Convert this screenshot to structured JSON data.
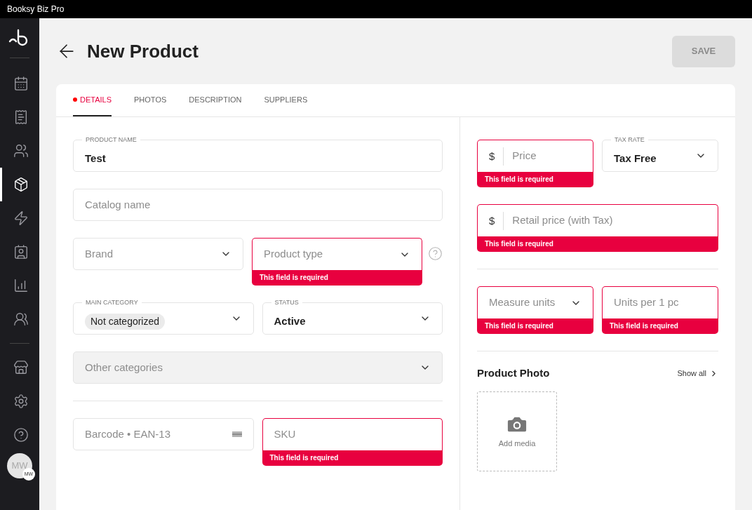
{
  "window": {
    "title": "Booksy Biz Pro"
  },
  "sidebar": {
    "items": [
      {
        "selected": false
      },
      {
        "selected": false
      },
      {
        "selected": false
      },
      {
        "selected": true
      },
      {
        "selected": false
      },
      {
        "selected": false
      },
      {
        "selected": false
      },
      {
        "selected": false
      }
    ],
    "bottom_items": [
      {
        "selected": false
      },
      {
        "selected": false
      },
      {
        "selected": false
      }
    ],
    "avatar": {
      "initials": "MW",
      "badge": "MW"
    }
  },
  "header": {
    "title": "New Product",
    "save_button": {
      "label": "SAVE",
      "disabled": true
    }
  },
  "tabs": [
    {
      "label": "DETAILS",
      "selected": true,
      "alert": true
    },
    {
      "label": "PHOTOS",
      "selected": false,
      "alert": false
    },
    {
      "label": "DESCRIPTION",
      "selected": false,
      "alert": false
    },
    {
      "label": "SUPPLIERS",
      "selected": false,
      "alert": false
    }
  ],
  "left_rows": [
    {
      "kind": "fields",
      "fields": [
        {
          "kind": "input",
          "label": "PRODUCT NAME",
          "value": "Test",
          "disabled": false
        }
      ]
    },
    {
      "kind": "fields",
      "fields": [
        {
          "kind": "input",
          "placeholder": "Catalog name",
          "disabled": false
        }
      ]
    },
    {
      "kind": "fields",
      "help": true,
      "fields": [
        {
          "kind": "select",
          "placeholder": "Brand",
          "disabled": false
        },
        {
          "kind": "select",
          "placeholder": "Product type",
          "error": "This field is required",
          "disabled": false
        }
      ]
    },
    {
      "kind": "fields",
      "fields": [
        {
          "kind": "select",
          "label": "MAIN CATEGORY",
          "tag": "Not categorized",
          "disabled": false
        },
        {
          "kind": "select",
          "label": "STATUS",
          "value": "Active",
          "disabled": false
        }
      ]
    },
    {
      "kind": "fields",
      "fields": [
        {
          "kind": "select",
          "placeholder": "Other categories",
          "disabled": true
        }
      ]
    },
    {
      "kind": "divider"
    },
    {
      "kind": "fields",
      "fields": [
        {
          "kind": "input",
          "placeholder": "Barcode • EAN-13",
          "barcode": true,
          "disabled": false
        },
        {
          "kind": "input",
          "placeholder": "SKU",
          "error": "This field is required",
          "disabled": false
        }
      ]
    }
  ],
  "right_rows": [
    {
      "kind": "fields",
      "fields": [
        {
          "kind": "input",
          "prefix": "$",
          "placeholder": "Price",
          "error": "This field is required",
          "disabled": false
        },
        {
          "kind": "select",
          "label": "TAX RATE",
          "value": "Tax Free",
          "disabled": false
        }
      ]
    },
    {
      "kind": "fields",
      "fields": [
        {
          "kind": "input",
          "prefix": "$",
          "placeholder": "Retail price (with Tax)",
          "error": "This field is required",
          "disabled": false
        }
      ]
    },
    {
      "kind": "divider"
    },
    {
      "kind": "fields",
      "fields": [
        {
          "kind": "select",
          "placeholder": "Measure units",
          "error": "This field is required",
          "disabled": false
        },
        {
          "kind": "input",
          "placeholder": "Units per 1 pc",
          "error": "This field is required",
          "disabled": false
        }
      ]
    },
    {
      "kind": "divider"
    }
  ],
  "product_photo": {
    "title": "Product Photo",
    "show_all": "Show all",
    "add_media": "Add media"
  }
}
